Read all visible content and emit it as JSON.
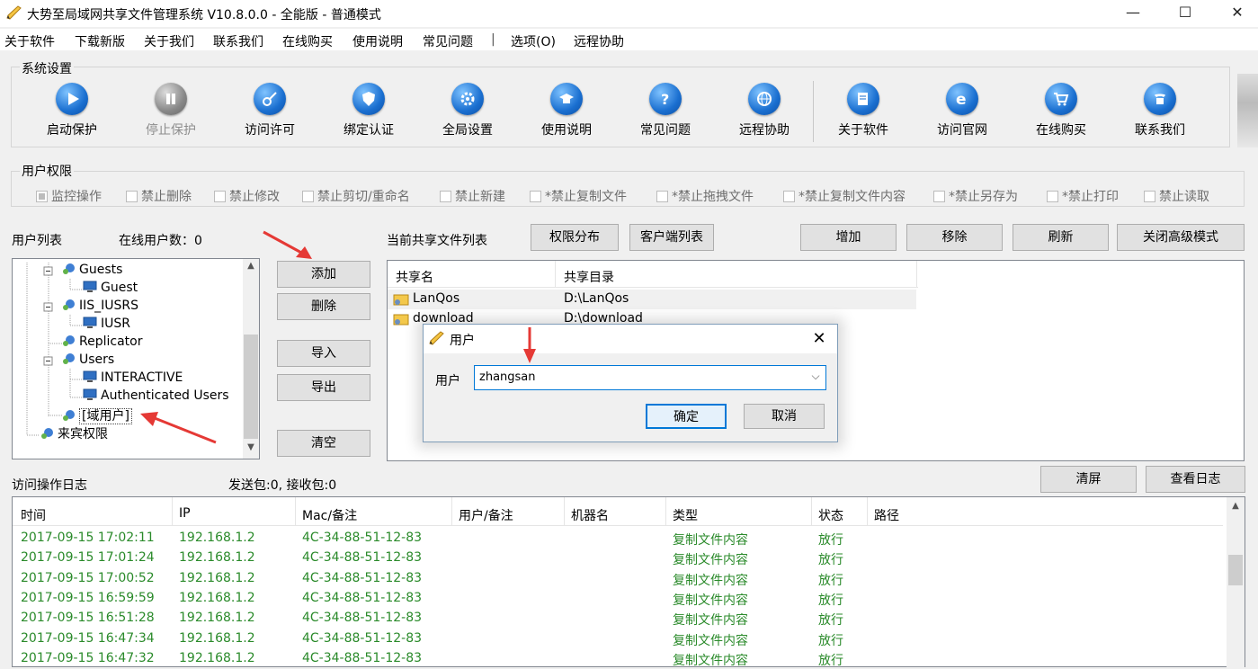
{
  "window": {
    "title": "大势至局域网共享文件管理系统 V10.8.0.0 - 全能版 - 普通模式",
    "minimize_label": "—",
    "maximize_label": "☐",
    "close_label": "✕"
  },
  "menu": [
    "关于软件",
    "下载新版",
    "关于我们",
    "联系我们",
    "在线购买",
    "使用说明",
    "常见问题",
    "|",
    "选项(O)",
    "远程协助"
  ],
  "system_settings": {
    "label": "系统设置",
    "tools": [
      {
        "label": "启动保护",
        "icon": "play-icon",
        "enabled": true
      },
      {
        "label": "停止保护",
        "icon": "pause-icon",
        "enabled": false
      },
      {
        "label": "访问许可",
        "icon": "key-icon",
        "enabled": true
      },
      {
        "label": "绑定认证",
        "icon": "shield-icon",
        "enabled": true
      },
      {
        "label": "全局设置",
        "icon": "gear-icon",
        "enabled": true
      },
      {
        "label": "使用说明",
        "icon": "graduation-cap-icon",
        "enabled": true
      },
      {
        "label": "常见问题",
        "icon": "question-icon",
        "enabled": true
      },
      {
        "label": "远程协助",
        "icon": "globe-icon",
        "enabled": true
      },
      {
        "label": "关于软件",
        "icon": "document-icon",
        "enabled": true
      },
      {
        "label": "访问官网",
        "icon": "ie-icon",
        "enabled": true
      },
      {
        "label": "在线购买",
        "icon": "cart-icon",
        "enabled": true
      },
      {
        "label": "联系我们",
        "icon": "phone-icon",
        "enabled": true
      }
    ]
  },
  "user_permissions": {
    "label": "用户权限",
    "options": [
      {
        "label": "监控操作",
        "checked": true
      },
      {
        "label": "禁止删除",
        "checked": false
      },
      {
        "label": "禁止修改",
        "checked": false
      },
      {
        "label": "禁止剪切/重命名",
        "checked": false
      },
      {
        "label": "禁止新建",
        "checked": false
      },
      {
        "label": "*禁止复制文件",
        "checked": false
      },
      {
        "label": "*禁止拖拽文件",
        "checked": false
      },
      {
        "label": "*禁止复制文件内容",
        "checked": false
      },
      {
        "label": "*禁止另存为",
        "checked": false
      },
      {
        "label": "*禁止打印",
        "checked": false
      },
      {
        "label": "禁止读取",
        "checked": false
      }
    ]
  },
  "user_list": {
    "label": "用户列表",
    "online_label": "在线用户数：0",
    "tree": [
      {
        "label": "Guests",
        "level": 1,
        "kind": "group"
      },
      {
        "label": "Guest",
        "level": 2,
        "kind": "user"
      },
      {
        "label": "IIS_IUSRS",
        "level": 1,
        "kind": "group"
      },
      {
        "label": "IUSR",
        "level": 2,
        "kind": "user"
      },
      {
        "label": "Replicator",
        "level": 1,
        "kind": "group"
      },
      {
        "label": "Users",
        "level": 1,
        "kind": "group"
      },
      {
        "label": "INTERACTIVE",
        "level": 2,
        "kind": "user"
      },
      {
        "label": "Authenticated Users",
        "level": 2,
        "kind": "user"
      },
      {
        "label": "[域用户]",
        "level": 1,
        "kind": "group"
      },
      {
        "label": "来宾权限",
        "level": 0,
        "kind": "group"
      }
    ],
    "buttons": {
      "add": "添加",
      "delete": "删除",
      "import": "导入",
      "export": "导出",
      "clear": "清空"
    }
  },
  "shares": {
    "label": "当前共享文件列表",
    "buttons": {
      "perm": "权限分布",
      "clients": "客户端列表",
      "add": "增加",
      "remove": "移除",
      "refresh": "刷新",
      "close_adv": "关闭高级模式"
    },
    "columns": [
      "共享名",
      "共享目录"
    ],
    "rows": [
      {
        "name": "LanQos",
        "path": "D:\\LanQos"
      },
      {
        "name": "download",
        "path": "D:\\download"
      }
    ]
  },
  "log": {
    "label": "访问操作日志",
    "packets": "发送包:0, 接收包:0",
    "buttons": {
      "clear": "清屏",
      "view": "查看日志"
    },
    "columns": [
      "时间",
      "IP",
      "Mac/备注",
      "用户/备注",
      "机器名",
      "类型",
      "状态",
      "路径"
    ],
    "rows": [
      {
        "time": "2017-09-15 17:02:11",
        "ip": "192.168.1.2",
        "mac": "4C-34-88-51-12-83",
        "type": "复制文件内容",
        "status": "放行"
      },
      {
        "time": "2017-09-15 17:01:24",
        "ip": "192.168.1.2",
        "mac": "4C-34-88-51-12-83",
        "type": "复制文件内容",
        "status": "放行"
      },
      {
        "time": "2017-09-15 17:00:52",
        "ip": "192.168.1.2",
        "mac": "4C-34-88-51-12-83",
        "type": "复制文件内容",
        "status": "放行"
      },
      {
        "time": "2017-09-15 16:59:59",
        "ip": "192.168.1.2",
        "mac": "4C-34-88-51-12-83",
        "type": "复制文件内容",
        "status": "放行"
      },
      {
        "time": "2017-09-15 16:51:28",
        "ip": "192.168.1.2",
        "mac": "4C-34-88-51-12-83",
        "type": "复制文件内容",
        "status": "放行"
      },
      {
        "time": "2017-09-15 16:47:34",
        "ip": "192.168.1.2",
        "mac": "4C-34-88-51-12-83",
        "type": "复制文件内容",
        "status": "放行"
      },
      {
        "time": "2017-09-15 16:47:32",
        "ip": "192.168.1.2",
        "mac": "4C-34-88-51-12-83",
        "type": "复制文件内容",
        "status": "放行"
      }
    ]
  },
  "dialog": {
    "title": "用户",
    "field_label": "用户",
    "value": "zhangsan",
    "ok": "确定",
    "cancel": "取消"
  },
  "colors": {
    "accent": "#1a6fd0",
    "log_green": "#2a8a2a",
    "arrow_red": "#e53935"
  }
}
